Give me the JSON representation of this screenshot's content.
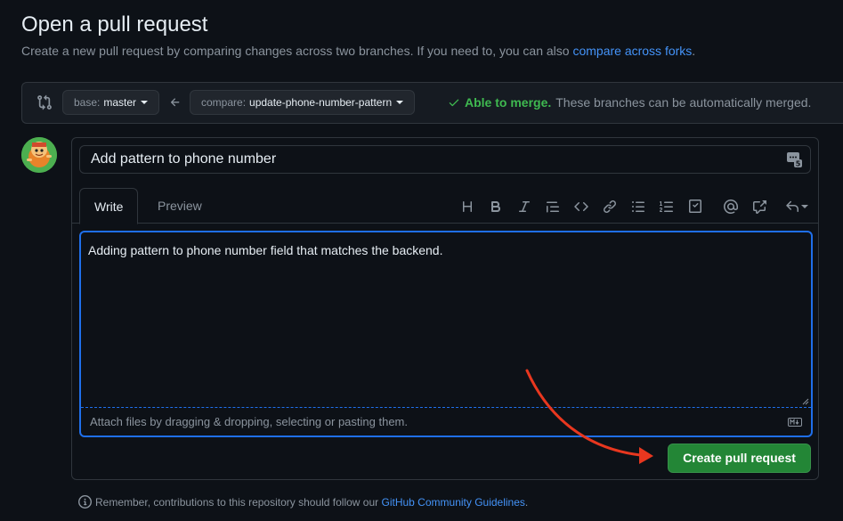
{
  "page": {
    "title": "Open a pull request",
    "subtitle": "Create a new pull request by comparing changes across two branches. If you need to, you can also",
    "subtitle_link": "compare across forks",
    "subtitle_end": "."
  },
  "branch_bar": {
    "base_prefix": "base:",
    "base_value": "master",
    "compare_prefix": "compare:",
    "compare_value": "update-phone-number-pattern",
    "merge_ok": "Able to merge.",
    "merge_text": "These branches can be automatically merged."
  },
  "form": {
    "title_value": "Add pattern to phone number",
    "saved_replies_count": "5",
    "tabs": [
      {
        "label": "Write"
      },
      {
        "label": "Preview"
      }
    ],
    "toolbar": {
      "heading": "H",
      "bold": "B",
      "italic": "I",
      "code": "<>"
    },
    "comment_value": "Adding pattern to phone number field that matches the backend.",
    "attach_text": "Attach files by dragging & dropping, selecting or pasting them.",
    "submit_label": "Create pull request"
  },
  "footer": {
    "text": "Remember, contributions to this repository should follow our",
    "link": "GitHub Community Guidelines",
    "end": "."
  },
  "colors": {
    "accent_green": "#238636",
    "merge_green": "#3fb950",
    "link_blue": "#4493f8",
    "focus_blue": "#1f6feb",
    "annotation_red": "#e8371f"
  }
}
